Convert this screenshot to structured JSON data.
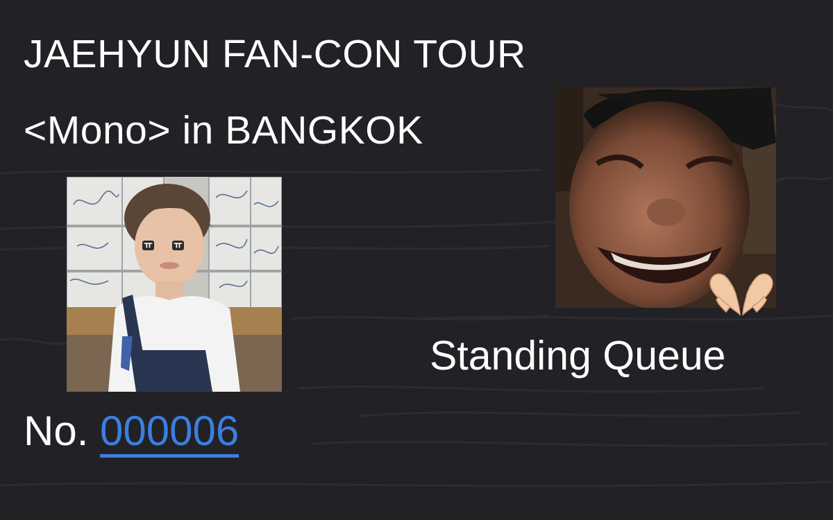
{
  "title": {
    "line1": "JAEHYUN FAN-CON TOUR",
    "line2": "<Mono> in BANGKOK"
  },
  "queue_label": "Standing Queue",
  "number": {
    "prefix": "No.",
    "value": "000006"
  },
  "stickers": {
    "tear_left": "ㅠ",
    "tear_right": "ㅠ",
    "heart_hands": "heart-hands-icon"
  },
  "colors": {
    "background": "#222226",
    "text": "#ffffff",
    "link": "#3b7fe0"
  }
}
